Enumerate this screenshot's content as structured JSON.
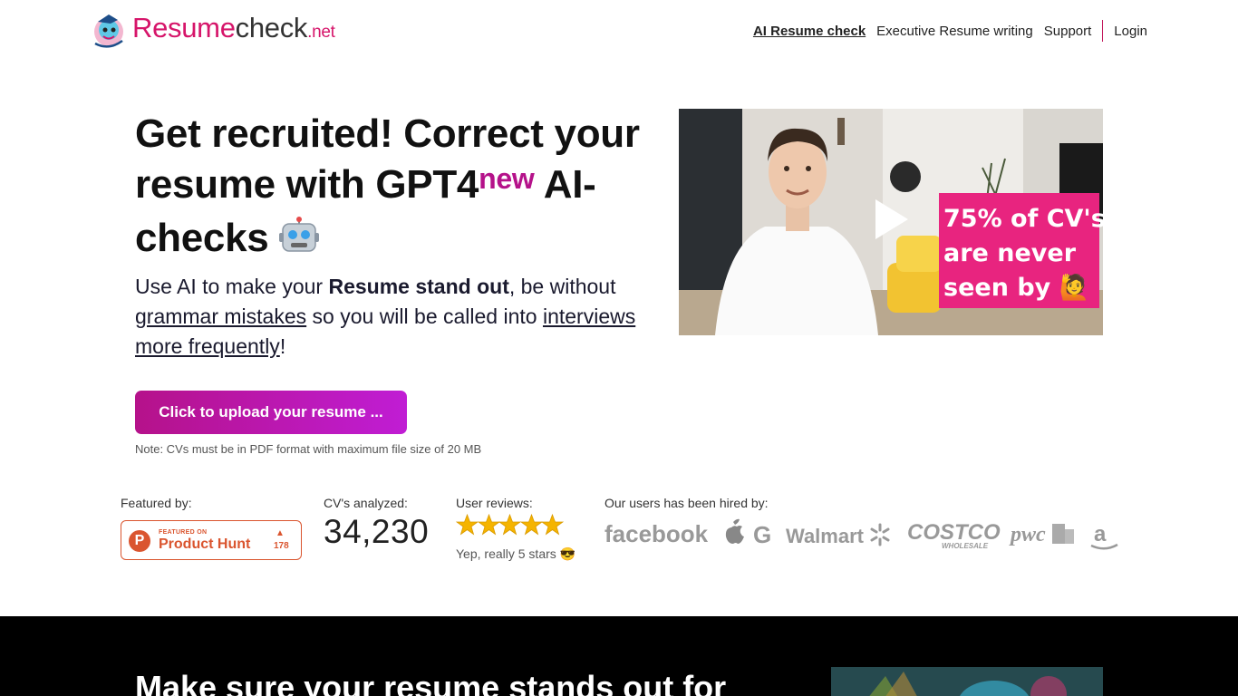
{
  "brand": {
    "part1": "Resume",
    "part2": "check",
    "part3": ".net"
  },
  "nav": {
    "ai_check": "AI Resume check",
    "executive": "Executive Resume writing",
    "support": "Support",
    "login": "Login"
  },
  "hero": {
    "headline_before": "Get recruited! Correct your resume with GPT4",
    "headline_sup": "new",
    "headline_after": " AI-checks ",
    "sub_p1": "Use AI to make your ",
    "sub_bold": "Resume stand out",
    "sub_p2": ", be without ",
    "sub_link1": "grammar mistakes",
    "sub_p3": " so you will be called into ",
    "sub_link2": "interviews more frequently",
    "sub_p4": "!",
    "upload_label": "Click to upload your resume ...",
    "note": "Note: CVs must be in PDF format with maximum file size of 20 MB"
  },
  "video": {
    "overlay_line1": "75% of CV's",
    "overlay_line2": "are never",
    "overlay_line3": "seen by 🙋"
  },
  "stats": {
    "featured_label": "Featured by:",
    "ph_top": "FEATURED ON",
    "ph_name": "Product Hunt",
    "ph_count": "178",
    "cv_label": "CV's analyzed:",
    "cv_count": "34,230",
    "reviews_label": "User reviews:",
    "reviews_stars": 5,
    "reviews_caption": "Yep, really 5 stars 😎",
    "hired_label": "Our users has been hired by:"
  },
  "brands": [
    "facebook",
    "G",
    "Walmart",
    "COSTCO",
    "WHOLESALE",
    "pwc",
    "a"
  ],
  "section2": {
    "title": "Make sure your resume stands out for"
  },
  "colors": {
    "accent": "#b5128a",
    "star": "#f5b400",
    "brand_pink": "#d6156a"
  }
}
